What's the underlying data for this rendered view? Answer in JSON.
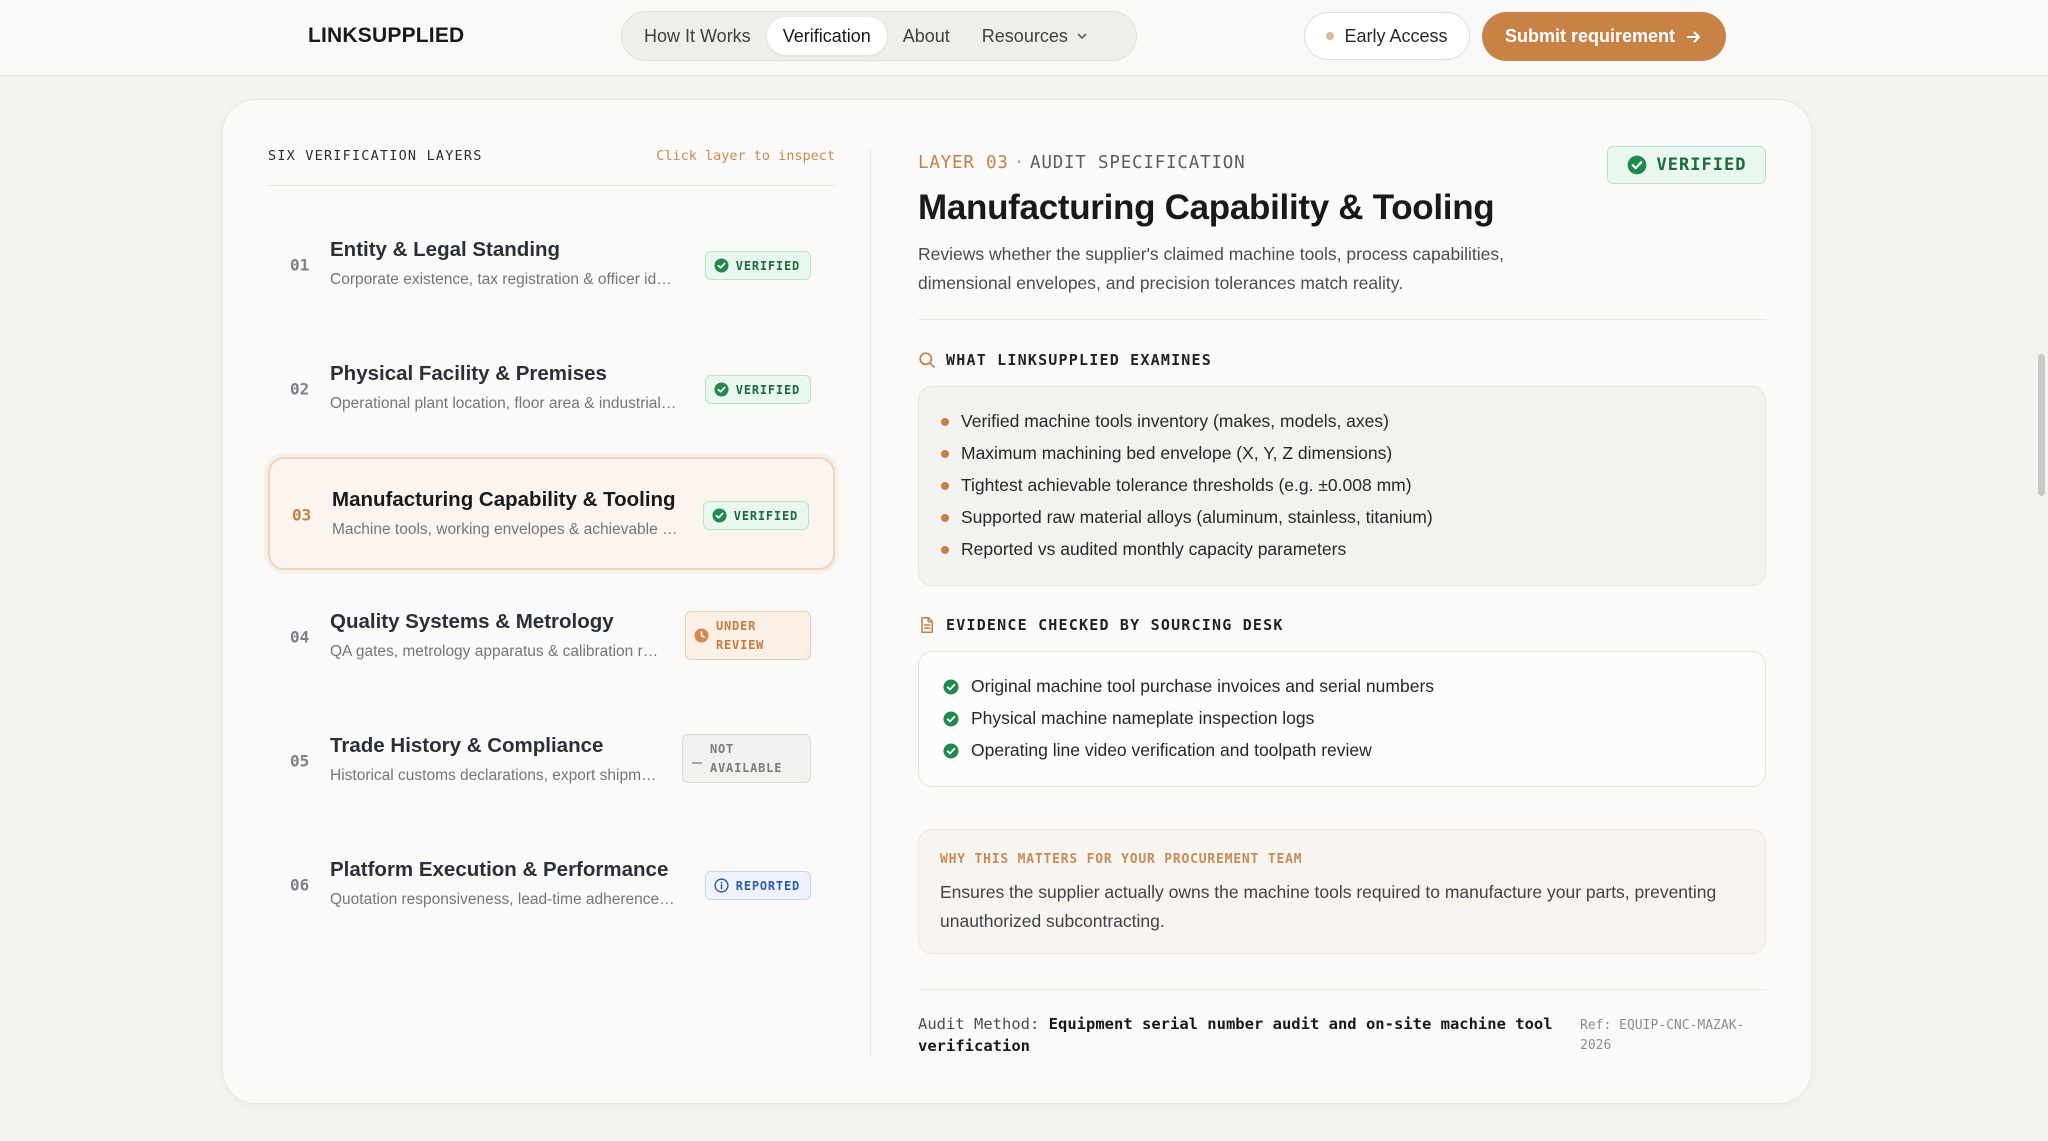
{
  "header": {
    "brand": "LINKSUPPLIED",
    "nav": [
      {
        "label": "How It Works"
      },
      {
        "label": "Verification",
        "active": true
      },
      {
        "label": "About"
      },
      {
        "label": "Resources"
      }
    ],
    "early_access": "Early Access",
    "submit": "Submit requirement"
  },
  "layers_panel": {
    "title": "SIX VERIFICATION LAYERS",
    "hint": "Click layer to inspect",
    "layers": [
      {
        "num": "01",
        "title": "Entity & Legal Standing",
        "subtitle": "Corporate existence, tax registration & officer identity",
        "status": "VERIFIED",
        "status_type": "verified"
      },
      {
        "num": "02",
        "title": "Physical Facility & Premises",
        "subtitle": "Operational plant location, floor area & industrial zoning",
        "status": "VERIFIED",
        "status_type": "verified"
      },
      {
        "num": "03",
        "title": "Manufacturing Capability & Tooling",
        "subtitle": "Machine tools, working envelopes & achievable tolerances",
        "status": "VERIFIED",
        "status_type": "verified",
        "selected": true
      },
      {
        "num": "04",
        "title": "Quality Systems & Metrology",
        "subtitle": "QA gates, metrology apparatus & calibration records",
        "status": "UNDER\nREVIEW",
        "status_type": "review"
      },
      {
        "num": "05",
        "title": "Trade History & Compliance",
        "subtitle": "Historical customs declarations, export shipments",
        "status": "NOT\nAVAILABLE",
        "status_type": "na"
      },
      {
        "num": "06",
        "title": "Platform Execution & Performance",
        "subtitle": "Quotation responsiveness, lead-time adherence & delivery",
        "status": "REPORTED",
        "status_type": "reported"
      }
    ]
  },
  "detail": {
    "layer_label": "LAYER 03",
    "separator": "·",
    "category": "AUDIT SPECIFICATION",
    "badge": "VERIFIED",
    "title": "Manufacturing Capability & Tooling",
    "description": "Reviews whether the supplier's claimed machine tools, process capabilities, dimensional envelopes, and precision tolerances match reality.",
    "examines_title": "WHAT LINKSUPPLIED EXAMINES",
    "examines": [
      "Verified machine tools inventory (makes, models, axes)",
      "Maximum machining bed envelope (X, Y, Z dimensions)",
      "Tightest achievable tolerance thresholds (e.g. ±0.008 mm)",
      "Supported raw material alloys (aluminum, stainless, titanium)",
      "Reported vs audited monthly capacity parameters"
    ],
    "evidence_title": "EVIDENCE CHECKED BY SOURCING DESK",
    "evidence": [
      "Original machine tool purchase invoices and serial numbers",
      "Physical machine nameplate inspection logs",
      "Operating line video verification and toolpath review"
    ],
    "why_title": "WHY THIS MATTERS FOR YOUR PROCUREMENT TEAM",
    "why_body": "Ensures the supplier actually owns the machine tools required to manufacture your parts, preventing unauthorized subcontracting.",
    "audit_label": "Audit Method:",
    "audit_method": "Equipment serial number audit and on-site machine tool verification",
    "ref": "Ref: EQUIP-CNC-MAZAK-2026"
  },
  "colors": {
    "accent": "#c88246",
    "verified": "#1a6b3e",
    "review": "#c57c44",
    "reported": "#2a5db0"
  }
}
